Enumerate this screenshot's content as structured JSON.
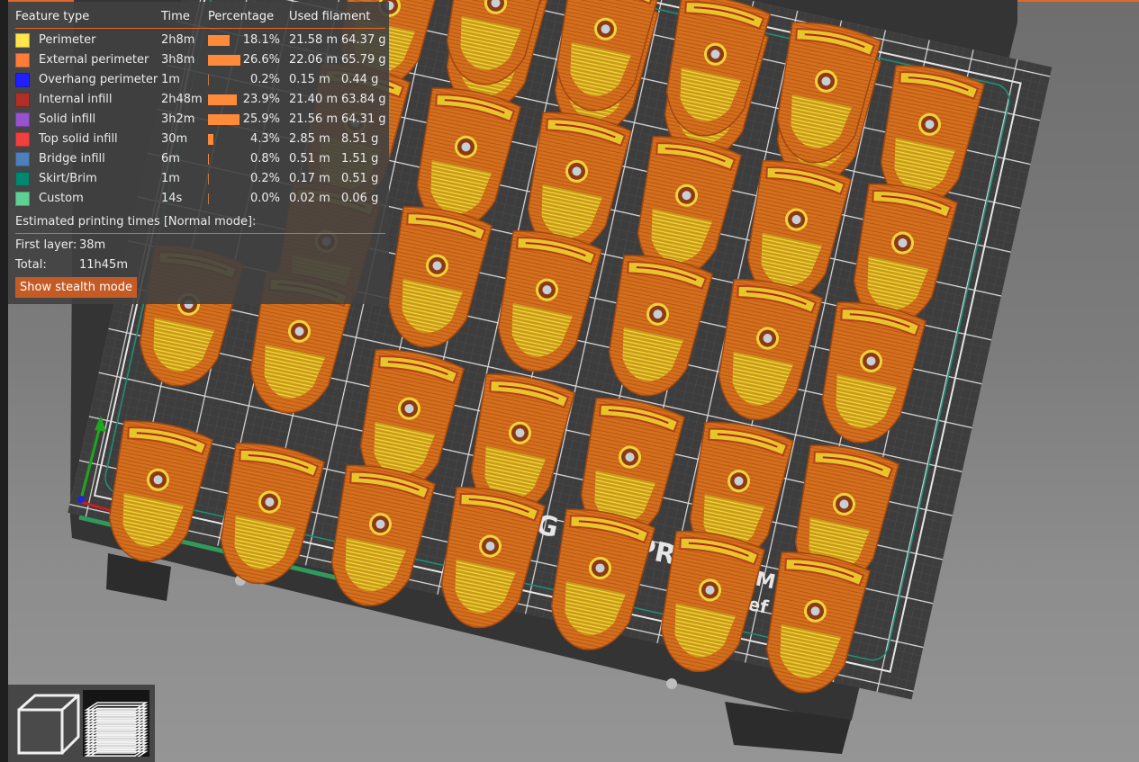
{
  "legend": {
    "headers": {
      "feature_type": "Feature type",
      "time": "Time",
      "percentage": "Percentage",
      "used_filament": "Used filament"
    },
    "rows": [
      {
        "name": "Perimeter",
        "color": "#ffe64d",
        "time": "2h8m",
        "percent": "18.1%",
        "fraction": 0.181,
        "length": "21.58 m",
        "weight": "64.37 g"
      },
      {
        "name": "External perimeter",
        "color": "#ff7d38",
        "time": "3h8m",
        "percent": "26.6%",
        "fraction": 0.266,
        "length": "22.06 m",
        "weight": "65.79 g"
      },
      {
        "name": "Overhang perimeter",
        "color": "#1f1fff",
        "time": "1m",
        "percent": "0.2%",
        "fraction": 0.002,
        "length": "0.15 m",
        "weight": "0.44 g"
      },
      {
        "name": "Internal infill",
        "color": "#b03029",
        "time": "2h48m",
        "percent": "23.9%",
        "fraction": 0.239,
        "length": "21.40 m",
        "weight": "63.84 g"
      },
      {
        "name": "Solid infill",
        "color": "#9654cc",
        "time": "3h2m",
        "percent": "25.9%",
        "fraction": 0.259,
        "length": "21.56 m",
        "weight": "64.31 g"
      },
      {
        "name": "Top solid infill",
        "color": "#f04040",
        "time": "30m",
        "percent": "4.3%",
        "fraction": 0.043,
        "length": "2.85 m",
        "weight": "8.51 g"
      },
      {
        "name": "Bridge infill",
        "color": "#4d80ba",
        "time": "6m",
        "percent": "0.8%",
        "fraction": 0.008,
        "length": "0.51 m",
        "weight": "1.51 g"
      },
      {
        "name": "Skirt/Brim",
        "color": "#00876e",
        "time": "1m",
        "percent": "0.2%",
        "fraction": 0.002,
        "length": "0.17 m",
        "weight": "0.51 g"
      },
      {
        "name": "Custom",
        "color": "#5ed194",
        "time": "14s",
        "percent": "0.0%",
        "fraction": 0.0,
        "length": "0.02 m",
        "weight": "0.06 g"
      }
    ],
    "estimated_title": "Estimated printing times [Normal mode]:",
    "first_layer_label": "First layer:",
    "first_layer_value": "38m",
    "total_label": "Total:",
    "total_value": "11h45m",
    "stealth_button": "Show stealth mode"
  },
  "bed": {
    "logo_text": "PRUSA RESEARCH",
    "fragments_visible": [
      "RIG",
      "PRU",
      "MI",
      "sef P"
    ]
  },
  "toolbar": {
    "buttons": [
      {
        "name": "3D view",
        "icon": "cube-icon",
        "active": false
      },
      {
        "name": "Preview",
        "icon": "layers-icon",
        "active": true
      }
    ]
  },
  "colors": {
    "accent": "#e2672a",
    "model_orange": "#d8761f",
    "bed": "#3c3c3c",
    "panel": "#404040"
  }
}
